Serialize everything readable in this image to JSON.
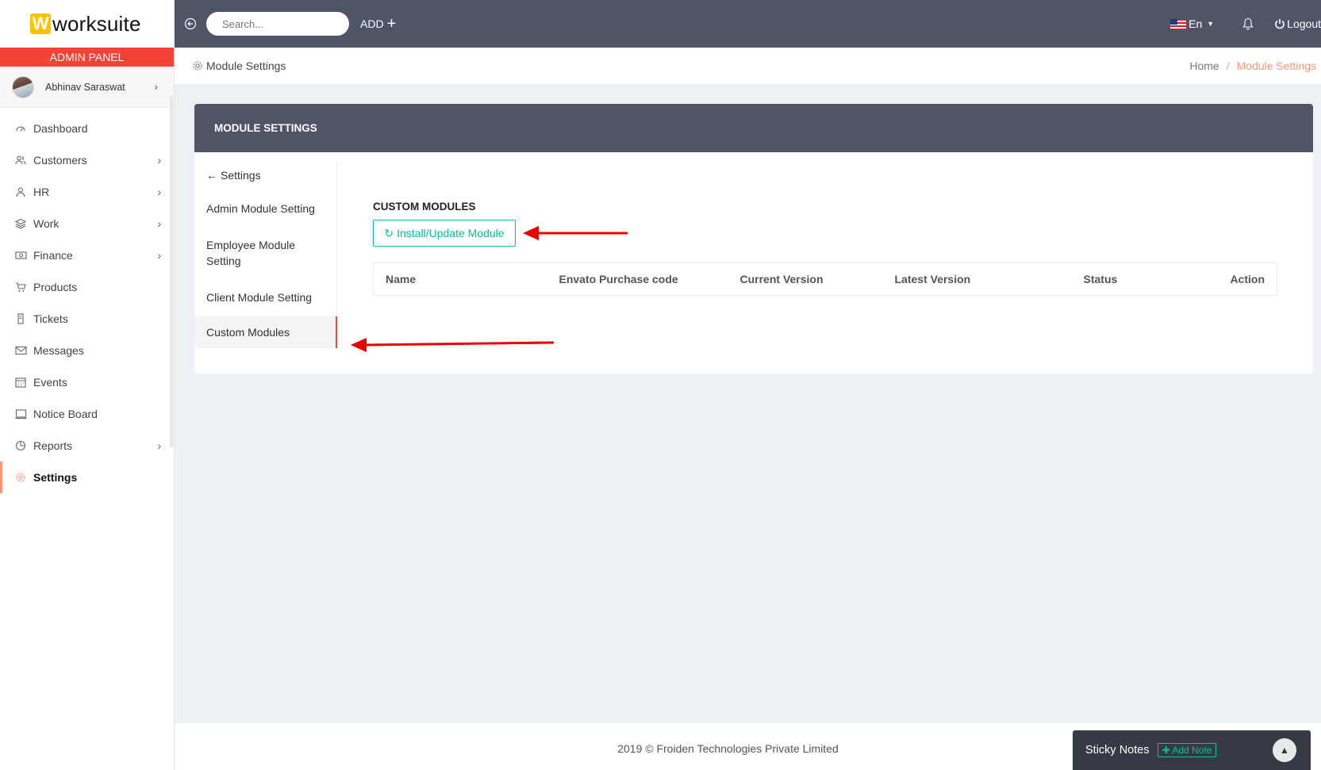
{
  "brand": {
    "logo_letter": "W",
    "name": "worksuite",
    "accent": "#fdc300"
  },
  "sidebar": {
    "panel_label": "ADMIN PANEL",
    "user_name": "Abhinav Saraswat",
    "items": [
      {
        "label": "Dashboard",
        "icon": "dashboard-icon",
        "has_children": false
      },
      {
        "label": "Customers",
        "icon": "customers-icon",
        "has_children": true
      },
      {
        "label": "HR",
        "icon": "user-icon",
        "has_children": true
      },
      {
        "label": "Work",
        "icon": "layers-icon",
        "has_children": true
      },
      {
        "label": "Finance",
        "icon": "money-icon",
        "has_children": true
      },
      {
        "label": "Products",
        "icon": "cart-icon",
        "has_children": false
      },
      {
        "label": "Tickets",
        "icon": "ticket-icon",
        "has_children": false
      },
      {
        "label": "Messages",
        "icon": "envelope-icon",
        "has_children": false
      },
      {
        "label": "Events",
        "icon": "calendar-icon",
        "has_children": false
      },
      {
        "label": "Notice Board",
        "icon": "screen-icon",
        "has_children": false
      },
      {
        "label": "Reports",
        "icon": "pie-chart-icon",
        "has_children": true
      },
      {
        "label": "Settings",
        "icon": "gear-icon",
        "has_children": false,
        "active": true
      }
    ]
  },
  "topbar": {
    "search_placeholder": "Search...",
    "add_label": "ADD",
    "lang_label": "En",
    "logout_label": "Logout",
    "bg_color": "#4f5467"
  },
  "page": {
    "title": "Module Settings",
    "breadcrumb_home": "Home",
    "breadcrumb_current": "Module Settings"
  },
  "card": {
    "header": "MODULE SETTINGS",
    "side_menu": {
      "back_label": "Settings",
      "items": [
        "Admin Module Setting",
        "Employee Module Setting",
        "Client Module Setting"
      ],
      "active_item": "Custom Modules"
    },
    "section_title": "CUSTOM MODULES",
    "install_button": "Install/Update Module",
    "table_headers": [
      "Name",
      "Envato Purchase code",
      "Current Version",
      "Latest Version",
      "Status",
      "Action"
    ]
  },
  "footer": {
    "copyright": "2019 © Froiden Technologies Private Limited"
  },
  "sticky_notes": {
    "title": "Sticky Notes",
    "add_label": "Add Note"
  },
  "colors": {
    "primary_red": "#f44336",
    "success_green": "#00c292",
    "accent_orange": "#fb9678"
  }
}
